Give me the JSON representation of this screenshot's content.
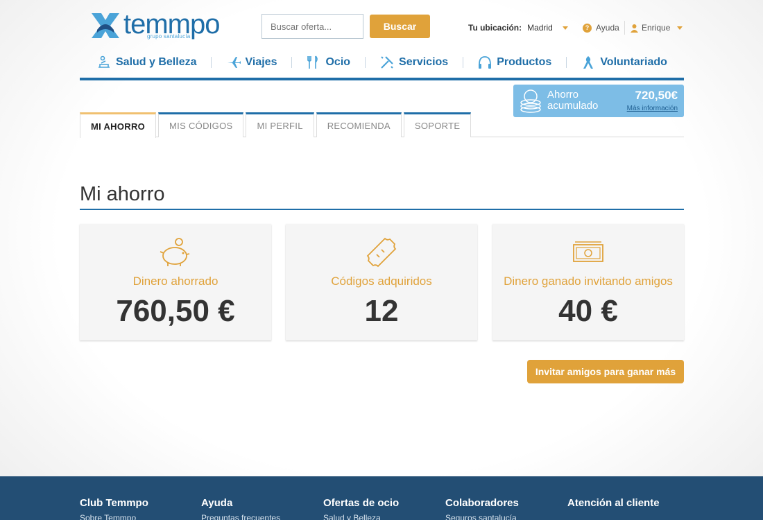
{
  "header": {
    "logo_text": "temmpo",
    "logo_sub": "grupo santalucía",
    "search_placeholder": "Buscar oferta...",
    "search_button": "Buscar",
    "location_label": "Tu ubicación:",
    "location_value": "Madrid",
    "help_label": "Ayuda",
    "user_name": "Enrique"
  },
  "nav": [
    {
      "label": "Salud y Belleza",
      "icon": "spa-icon"
    },
    {
      "label": "Viajes",
      "icon": "plane-icon"
    },
    {
      "label": "Ocio",
      "icon": "cutlery-icon"
    },
    {
      "label": "Servicios",
      "icon": "tools-icon"
    },
    {
      "label": "Productos",
      "icon": "headphones-icon"
    },
    {
      "label": "Voluntariado",
      "icon": "ribbon-icon"
    }
  ],
  "savings": {
    "label": "Ahorro acumulado",
    "amount": "720,50€",
    "more": "Más información"
  },
  "tabs": [
    "MI AHORRO",
    "MIS CÓDIGOS",
    "MI PERFIL",
    "RECOMIENDA",
    "SOPORTE"
  ],
  "main": {
    "title": "Mi ahorro",
    "cards": [
      {
        "label": "Dinero ahorrado",
        "value": "760,50 €",
        "icon": "piggy-bank-icon"
      },
      {
        "label": "Códigos adquiridos",
        "value": "12",
        "icon": "ticket-icon"
      },
      {
        "label": "Dinero ganado invitando amigos",
        "value": "40 €",
        "icon": "banknote-icon"
      }
    ],
    "invite_button": "Invitar amigos para ganar más"
  },
  "footer": {
    "columns": [
      {
        "title": "Club Temmpo",
        "first": "Sobre Temmpo"
      },
      {
        "title": "Ayuda",
        "first": "Preguntas frecuentes"
      },
      {
        "title": "Ofertas de ocio",
        "first": "Salud y Belleza"
      },
      {
        "title": "Colaboradores",
        "first": "Seguros santalucía"
      },
      {
        "title": "Atención al cliente",
        "first": ""
      }
    ]
  },
  "colors": {
    "brand": "#1f6ea8",
    "accent": "#e0a23a",
    "footer": "#234e74",
    "badge": "#7dbde6"
  }
}
